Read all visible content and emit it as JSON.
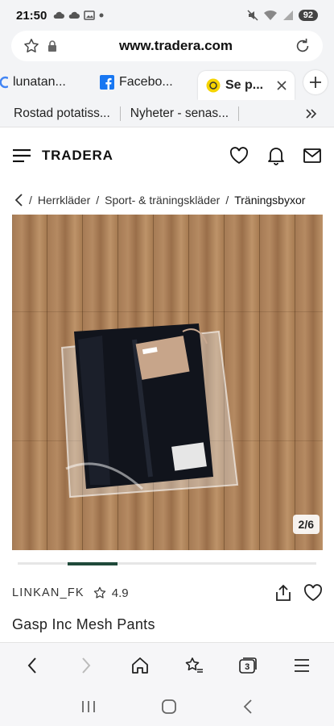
{
  "status_bar": {
    "time": "21:50",
    "battery": "92"
  },
  "url_bar": {
    "url": "www.tradera.com"
  },
  "tabs": [
    {
      "label": "lunatan..."
    },
    {
      "label": "Facebo..."
    },
    {
      "label": "Se p..."
    }
  ],
  "bookmarks": [
    {
      "label": "Rostad potatiss..."
    },
    {
      "label": "Nyheter - senas..."
    }
  ],
  "header": {
    "logo": "TRADERA"
  },
  "breadcrumb": {
    "items": [
      "Herrkläder",
      "Sport- & träningskläder"
    ],
    "current": "Träningsbyxor"
  },
  "gallery": {
    "counter": "2/6",
    "current_index": 2,
    "total": 6
  },
  "seller": {
    "name": "LINKAN_FK",
    "rating": "4.9"
  },
  "product": {
    "title": "Gasp Inc Mesh Pants"
  },
  "toolbar": {
    "tab_count": "3"
  },
  "colors": {
    "accent": "#1f4a3a",
    "wood": "#a67b55"
  }
}
